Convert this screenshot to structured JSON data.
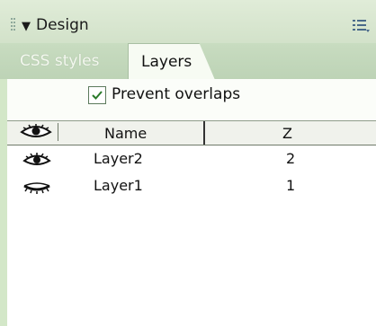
{
  "panel": {
    "title": "Design",
    "collapse_glyph": "▼",
    "options_icon": "panel-options-icon"
  },
  "tabs": [
    {
      "label": "CSS styles",
      "active": false
    },
    {
      "label": "Layers",
      "active": true
    }
  ],
  "prevent_overlaps": {
    "label": "Prevent overlaps",
    "checked": true
  },
  "table": {
    "columns": {
      "visibility": "eye-icon",
      "name": "Name",
      "z": "Z"
    },
    "rows": [
      {
        "name": "Layer2",
        "z": "2",
        "visibility": "eye-open-icon"
      },
      {
        "name": "Layer1",
        "z": "1",
        "visibility": "eye-closed-icon"
      }
    ]
  },
  "colors": {
    "panel_background": "#d3e7c8",
    "content_background": "#fbfdf9",
    "active_tab": "#f7fbf3"
  }
}
